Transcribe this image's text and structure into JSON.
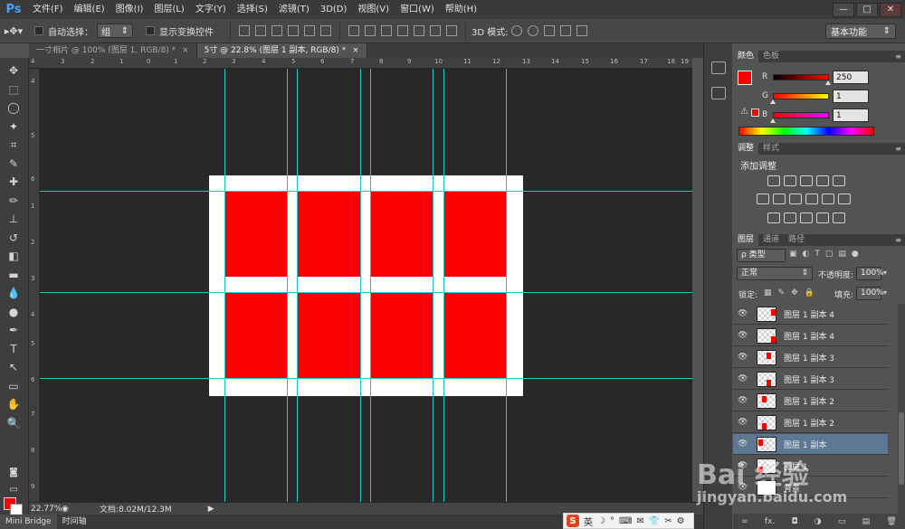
{
  "app": {
    "logo": "Ps"
  },
  "menu": [
    "文件(F)",
    "编辑(E)",
    "图像(I)",
    "图层(L)",
    "文字(Y)",
    "选择(S)",
    "滤镜(T)",
    "3D(D)",
    "视图(V)",
    "窗口(W)",
    "帮助(H)"
  ],
  "window_controls": [
    "—",
    "□",
    "✕"
  ],
  "options": {
    "auto_select_label": "自动选择：",
    "auto_select_value": "组",
    "show_transform_label": "显示变换控件",
    "mode_3d_label": "3D 模式:",
    "workspace": "基本功能"
  },
  "tabs": [
    {
      "label": "一寸相片 @ 100% (图层 1, RGB/8) *",
      "close": "×"
    },
    {
      "label": "5寸 @ 22.8% (图层 1 副本, RGB/8) *",
      "close": "×"
    }
  ],
  "ruler_top": [
    "4",
    "3",
    "2",
    "1",
    "0",
    "1",
    "2",
    "3",
    "4",
    "5",
    "6",
    "7",
    "8",
    "9",
    "10",
    "11",
    "12",
    "13",
    "14",
    "15",
    "16",
    "17",
    "18",
    "19"
  ],
  "ruler_left": [
    "4",
    "5",
    "6",
    "1",
    "2",
    "3",
    "4",
    "5",
    "6",
    "7",
    "8",
    "9"
  ],
  "tools": [
    "move-tool",
    "marquee-tool",
    "lasso-tool",
    "magic-wand-tool",
    "crop-tool",
    "eyedropper-tool",
    "healing-tool",
    "brush-tool",
    "stamp-tool",
    "history-brush-tool",
    "eraser-tool",
    "gradient-tool",
    "blur-tool",
    "dodge-tool",
    "pen-tool",
    "type-tool",
    "path-select-tool",
    "shape-tool",
    "hand-tool",
    "zoom-tool"
  ],
  "tool_glyphs": [
    "✥",
    "⬚",
    "◯",
    "✦",
    "⌗",
    "✎",
    "✚",
    "✏",
    "⊥",
    "↺",
    "◧",
    "▬",
    "💧",
    "●",
    "✒",
    "T",
    "↖",
    "▭",
    "✋",
    "🔍"
  ],
  "colors": {
    "foreground": "#fa0101",
    "background": "#ffffff",
    "guide": "#21c7c7",
    "photo": "#fa0101"
  },
  "status": {
    "zoom": "22.77%",
    "doc_info": "文档:8.02M/12.3M"
  },
  "bottom_tabs": [
    "Mini Bridge",
    "时间轴"
  ],
  "ime": {
    "logo": "S",
    "lang": "英",
    "icons": [
      "☽",
      "°",
      "⌨",
      "✉",
      "👕",
      "✂",
      "⚙"
    ]
  },
  "color_panel": {
    "tabs": [
      "颜色",
      "色板"
    ],
    "channels": [
      {
        "name": "R",
        "value": "250",
        "gradient": "linear-gradient(to right,#000101,#ff0101)"
      },
      {
        "name": "G",
        "value": "1",
        "gradient": "linear-gradient(to right,#fa0001,#faff01)"
      },
      {
        "name": "B",
        "value": "1",
        "gradient": "linear-gradient(to right,#fa0100,#fa01ff)"
      }
    ],
    "warning": "⚠"
  },
  "adjust_panel": {
    "tabs": [
      "调整",
      "样式"
    ],
    "title": "添加调整",
    "icons": [
      "brightness-icon",
      "levels-icon",
      "curves-icon",
      "exposure-icon",
      "vibrance-icon",
      "hue-sat-icon",
      "color-balance-icon",
      "bw-icon",
      "photo-filter-icon",
      "channel-mixer-icon",
      "color-lookup-icon",
      "invert-icon",
      "posterize-icon",
      "threshold-icon",
      "selective-color-icon",
      "gradient-map-icon"
    ]
  },
  "layers_panel": {
    "tabs": [
      "图层",
      "通道",
      "路径"
    ],
    "filter": "ρ 类型",
    "blend_mode": "正常",
    "opacity_label": "不透明度:",
    "opacity": "100%",
    "lock_label": "锁定:",
    "fill_label": "填充:",
    "fill": "100%",
    "layers": [
      {
        "name": "图层 1 副本 4",
        "selected": false
      },
      {
        "name": "图层 1 副本 4",
        "selected": false
      },
      {
        "name": "图层 1 副本 3",
        "selected": false
      },
      {
        "name": "图层 1 副本 3",
        "selected": false
      },
      {
        "name": "图层 1 副本 2",
        "selected": false
      },
      {
        "name": "图层 1 副本 2",
        "selected": false
      },
      {
        "name": "图层 1 副本",
        "selected": true
      },
      {
        "name": "图层 1",
        "selected": false
      },
      {
        "name": "背景",
        "selected": false
      }
    ],
    "footer_icons": [
      "∞",
      "fx.",
      "◘",
      "◑",
      "▭",
      "▤",
      "🗑"
    ]
  },
  "watermark": {
    "brand": "Bai 经验",
    "url": "jingyan.baidu.com"
  }
}
